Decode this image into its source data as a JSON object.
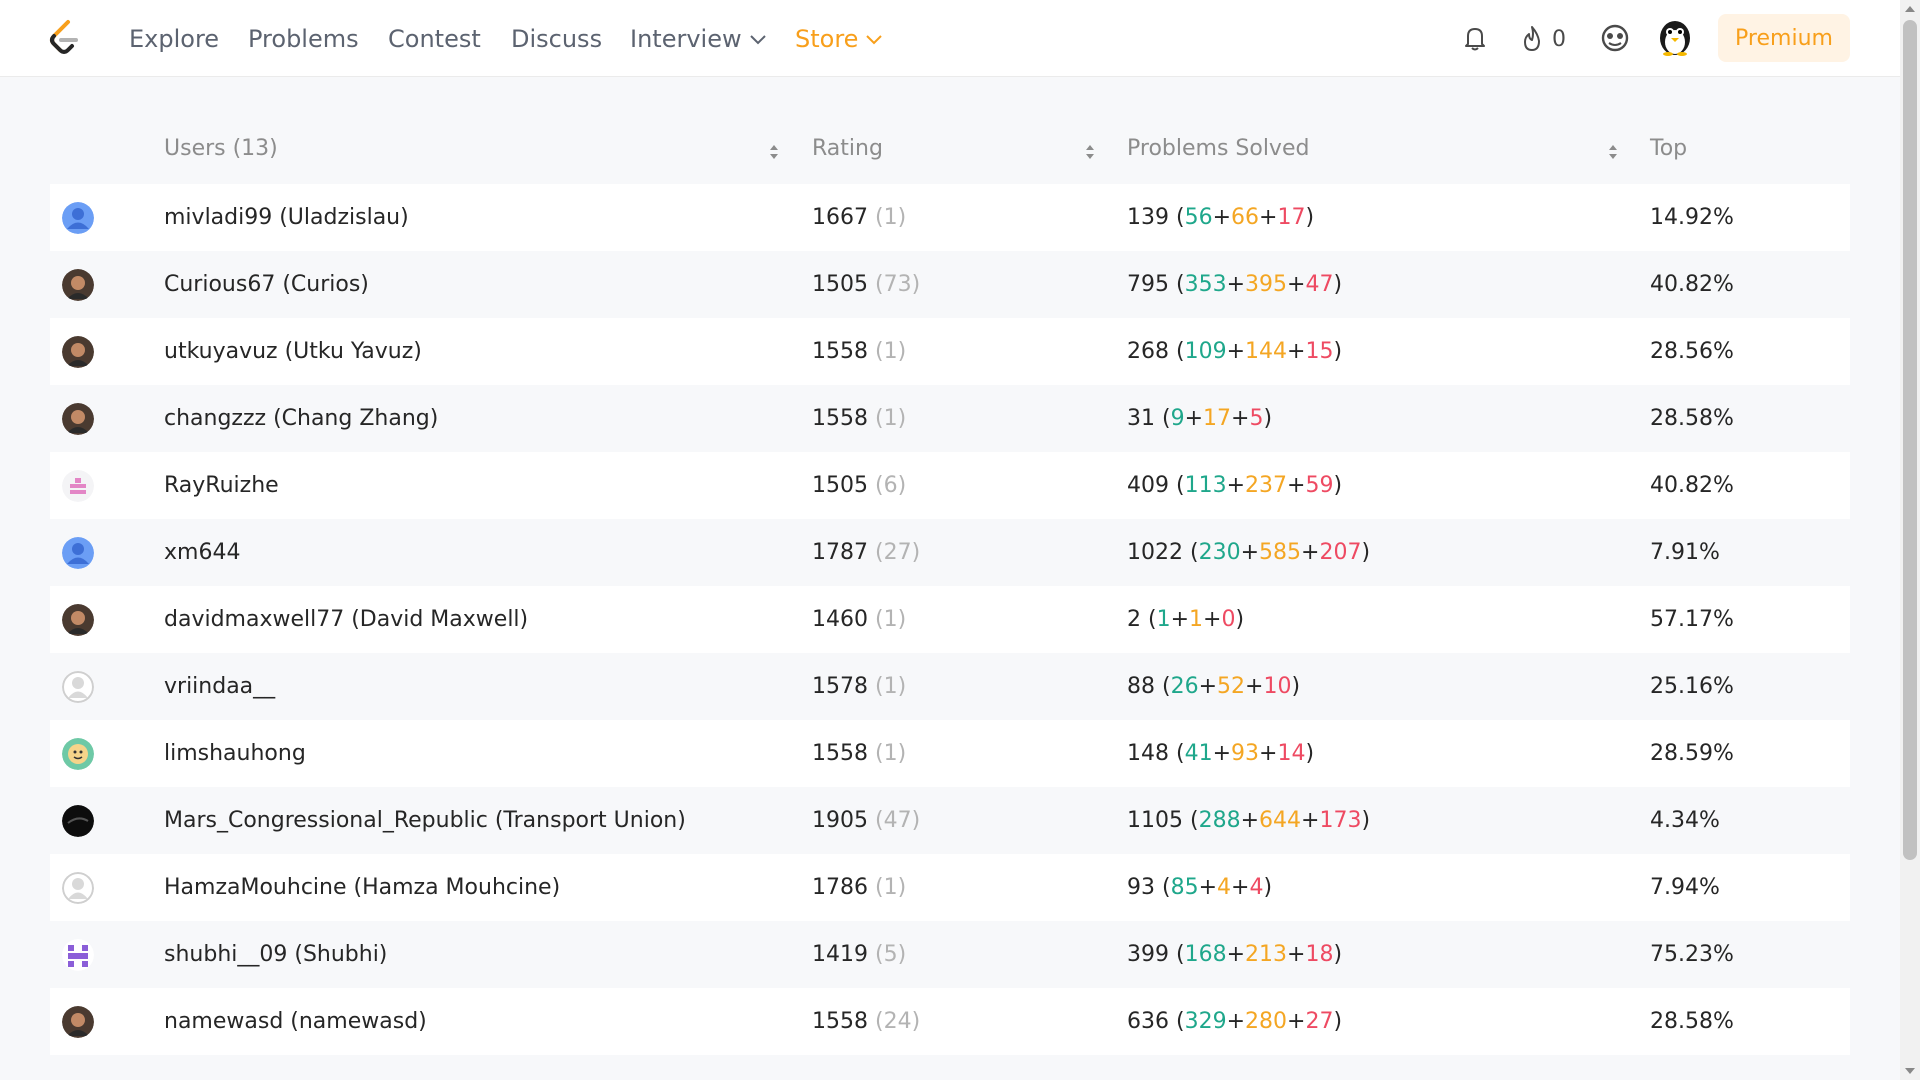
{
  "nav": {
    "links": [
      "Explore",
      "Problems",
      "Contest",
      "Discuss",
      "Interview",
      "Store"
    ],
    "streak_count": "0",
    "premium_label": "Premium",
    "accent_color": "#f89f1b"
  },
  "table": {
    "headers": {
      "users": "Users (13)",
      "rating": "Rating",
      "solved": "Problems Solved",
      "top": "Top"
    },
    "rows": [
      {
        "user": "mivladi99 (Uladzislau)",
        "rating": "1667",
        "contests": "(1)",
        "total": "139",
        "easy": "56",
        "medium": "66",
        "hard": "17",
        "top": "14.92%",
        "avatar": "default-blue"
      },
      {
        "user": "Curious67 (Curios)",
        "rating": "1505",
        "contests": "(73)",
        "total": "795",
        "easy": "353",
        "medium": "395",
        "hard": "47",
        "top": "40.82%",
        "avatar": "photo"
      },
      {
        "user": "utkuyavuz (Utku Yavuz)",
        "rating": "1558",
        "contests": "(1)",
        "total": "268",
        "easy": "109",
        "medium": "144",
        "hard": "15",
        "top": "28.56%",
        "avatar": "photo"
      },
      {
        "user": "changzzz (Chang Zhang)",
        "rating": "1558",
        "contests": "(1)",
        "total": "31",
        "easy": "9",
        "medium": "17",
        "hard": "5",
        "top": "28.58%",
        "avatar": "photo"
      },
      {
        "user": "RayRuizhe",
        "rating": "1505",
        "contests": "(6)",
        "total": "409",
        "easy": "113",
        "medium": "237",
        "hard": "59",
        "top": "40.82%",
        "avatar": "pink-pattern"
      },
      {
        "user": "xm644",
        "rating": "1787",
        "contests": "(27)",
        "total": "1022",
        "easy": "230",
        "medium": "585",
        "hard": "207",
        "top": "7.91%",
        "avatar": "default-blue"
      },
      {
        "user": "davidmaxwell77 (David Maxwell)",
        "rating": "1460",
        "contests": "(1)",
        "total": "2",
        "easy": "1",
        "medium": "1",
        "hard": "0",
        "top": "57.17%",
        "avatar": "photo"
      },
      {
        "user": "vriindaa__",
        "rating": "1578",
        "contests": "(1)",
        "total": "88",
        "easy": "26",
        "medium": "52",
        "hard": "10",
        "top": "25.16%",
        "avatar": "default-gray"
      },
      {
        "user": "limshauhong",
        "rating": "1558",
        "contests": "(1)",
        "total": "148",
        "easy": "41",
        "medium": "93",
        "hard": "14",
        "top": "28.59%",
        "avatar": "cartoon"
      },
      {
        "user": "Mars_Congressional_Republic (Transport Union)",
        "rating": "1905",
        "contests": "(47)",
        "total": "1105",
        "easy": "288",
        "medium": "644",
        "hard": "173",
        "top": "4.34%",
        "avatar": "dark"
      },
      {
        "user": "HamzaMouhcine (Hamza Mouhcine)",
        "rating": "1786",
        "contests": "(1)",
        "total": "93",
        "easy": "85",
        "medium": "4",
        "hard": "4",
        "top": "7.94%",
        "avatar": "default-gray"
      },
      {
        "user": "shubhi__09 (Shubhi)",
        "rating": "1419",
        "contests": "(5)",
        "total": "399",
        "easy": "168",
        "medium": "213",
        "hard": "18",
        "top": "75.23%",
        "avatar": "purple-pattern"
      },
      {
        "user": "namewasd (namewasd)",
        "rating": "1558",
        "contests": "(24)",
        "total": "636",
        "easy": "329",
        "medium": "280",
        "hard": "27",
        "top": "28.58%",
        "avatar": "photo"
      }
    ]
  }
}
